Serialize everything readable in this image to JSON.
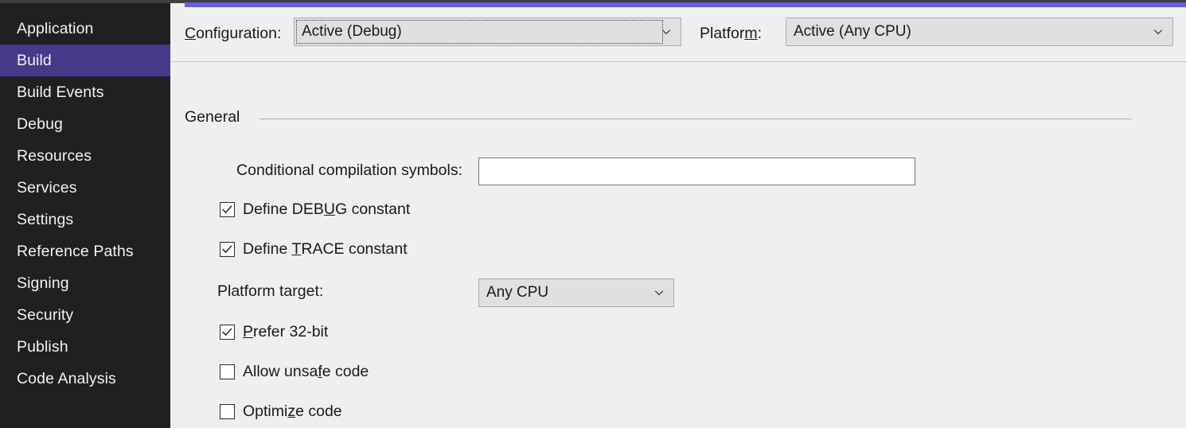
{
  "window": {
    "accent_color": "#6b5fe0",
    "chrome_color": "#3f3f3f"
  },
  "sidebar": {
    "background_color": "#202020",
    "selected_color": "#453a8a",
    "items": [
      {
        "label": "Application",
        "selected": false
      },
      {
        "label": "Build",
        "selected": true
      },
      {
        "label": "Build Events",
        "selected": false
      },
      {
        "label": "Debug",
        "selected": false
      },
      {
        "label": "Resources",
        "selected": false
      },
      {
        "label": "Services",
        "selected": false
      },
      {
        "label": "Settings",
        "selected": false
      },
      {
        "label": "Reference Paths",
        "selected": false
      },
      {
        "label": "Signing",
        "selected": false
      },
      {
        "label": "Security",
        "selected": false
      },
      {
        "label": "Publish",
        "selected": false
      },
      {
        "label": "Code Analysis",
        "selected": false
      }
    ]
  },
  "config_row": {
    "configuration": {
      "label_pre": "",
      "label_accel": "C",
      "label_post": "onfiguration:",
      "value": "Active (Debug)",
      "chevron_icon": "chevron-down-icon",
      "focused": true
    },
    "platform": {
      "label_pre": "Platfor",
      "label_accel": "m",
      "label_post": ":",
      "value": "Active (Any CPU)",
      "chevron_icon": "chevron-down-icon",
      "focused": false
    }
  },
  "general": {
    "heading": "General",
    "conditional_symbols": {
      "label": "Conditional compilation symbols:",
      "value": "",
      "placeholder": ""
    },
    "define_debug": {
      "label_pre": "Define DEB",
      "label_accel": "U",
      "label_post": "G constant",
      "checked": true
    },
    "define_trace": {
      "label_pre": "Define ",
      "label_accel": "T",
      "label_post": "RACE constant",
      "checked": true
    },
    "platform_target": {
      "label": "Platform target:",
      "value": "Any CPU",
      "chevron_icon": "chevron-down-icon"
    },
    "prefer_32bit": {
      "label_pre": "",
      "label_accel": "P",
      "label_post": "refer 32-bit",
      "checked": true
    },
    "allow_unsafe": {
      "label_pre": "Allow unsa",
      "label_accel": "f",
      "label_post": "e code",
      "checked": false
    },
    "optimize_code": {
      "label_pre": "Optimi",
      "label_accel": "z",
      "label_post": "e code",
      "checked": false
    }
  }
}
